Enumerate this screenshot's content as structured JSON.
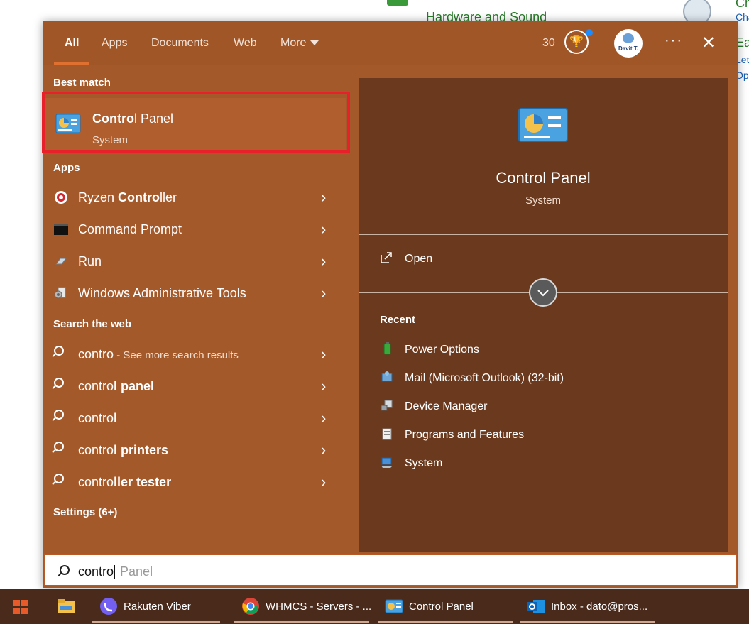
{
  "background": {
    "hardware_link": "Hardware and Sound",
    "right_snippets": [
      "Ch",
      "Cha",
      "Ea",
      "Let",
      "Op"
    ]
  },
  "flyout": {
    "tabs": [
      {
        "label": "All",
        "active": true
      },
      {
        "label": "Apps",
        "active": false
      },
      {
        "label": "Documents",
        "active": false
      },
      {
        "label": "Web",
        "active": false
      },
      {
        "label": "More",
        "active": false
      }
    ],
    "rewards_count": "30",
    "avatar_text": "Davit T.",
    "more_label": "···",
    "close_label": "✕",
    "best_match": {
      "heading": "Best match",
      "title_bold": "Contro",
      "title_rest": "l Panel",
      "subtitle": "System"
    },
    "apps": {
      "heading": "Apps",
      "items": [
        {
          "pre": "Ryzen ",
          "bold": "Contro",
          "post": "ller",
          "icon": "ryzen-icon"
        },
        {
          "pre": "Command Prompt",
          "bold": "",
          "post": "",
          "icon": "cmd-icon"
        },
        {
          "pre": "Run",
          "bold": "",
          "post": "",
          "icon": "run-icon"
        },
        {
          "pre": "Windows Administrative Tools",
          "bold": "",
          "post": "",
          "icon": "admin-tools-icon"
        }
      ]
    },
    "web": {
      "heading": "Search the web",
      "items": [
        {
          "pre": "contro",
          "bold": "",
          "hint": " - See more search results"
        },
        {
          "pre": "contro",
          "bold": "l panel",
          "hint": ""
        },
        {
          "pre": "contro",
          "bold": "l",
          "hint": ""
        },
        {
          "pre": "contro",
          "bold": "l printers",
          "hint": ""
        },
        {
          "pre": "contro",
          "bold": "ller tester",
          "hint": ""
        }
      ]
    },
    "settings_heading": "Settings (6+)",
    "chevron": "›",
    "preview": {
      "title": "Control Panel",
      "subtitle": "System",
      "open_label": "Open",
      "recent_heading": "Recent",
      "recent": [
        {
          "label": "Power Options",
          "icon": "power-options-icon",
          "color": "#3aa83a"
        },
        {
          "label": "Mail (Microsoft Outlook) (32-bit)",
          "icon": "mail-icon",
          "color": "#6fa6d6"
        },
        {
          "label": "Device Manager",
          "icon": "device-manager-icon",
          "color": "#9aa0a8"
        },
        {
          "label": "Programs and Features",
          "icon": "programs-icon",
          "color": "#c8c8c8"
        },
        {
          "label": "System",
          "icon": "system-icon",
          "color": "#4a90d9"
        }
      ]
    }
  },
  "search": {
    "typed": "contro",
    "suggestion": "Panel"
  },
  "taskbar": {
    "items": [
      {
        "label": "",
        "icon": "file-explorer-icon"
      },
      {
        "label": "Rakuten Viber",
        "icon": "viber-icon"
      },
      {
        "label": "WHMCS - Servers - ...",
        "icon": "chrome-icon"
      },
      {
        "label": "Control Panel",
        "icon": "control-panel-icon"
      },
      {
        "label": "Inbox - dato@pros...",
        "icon": "outlook-icon"
      }
    ]
  }
}
